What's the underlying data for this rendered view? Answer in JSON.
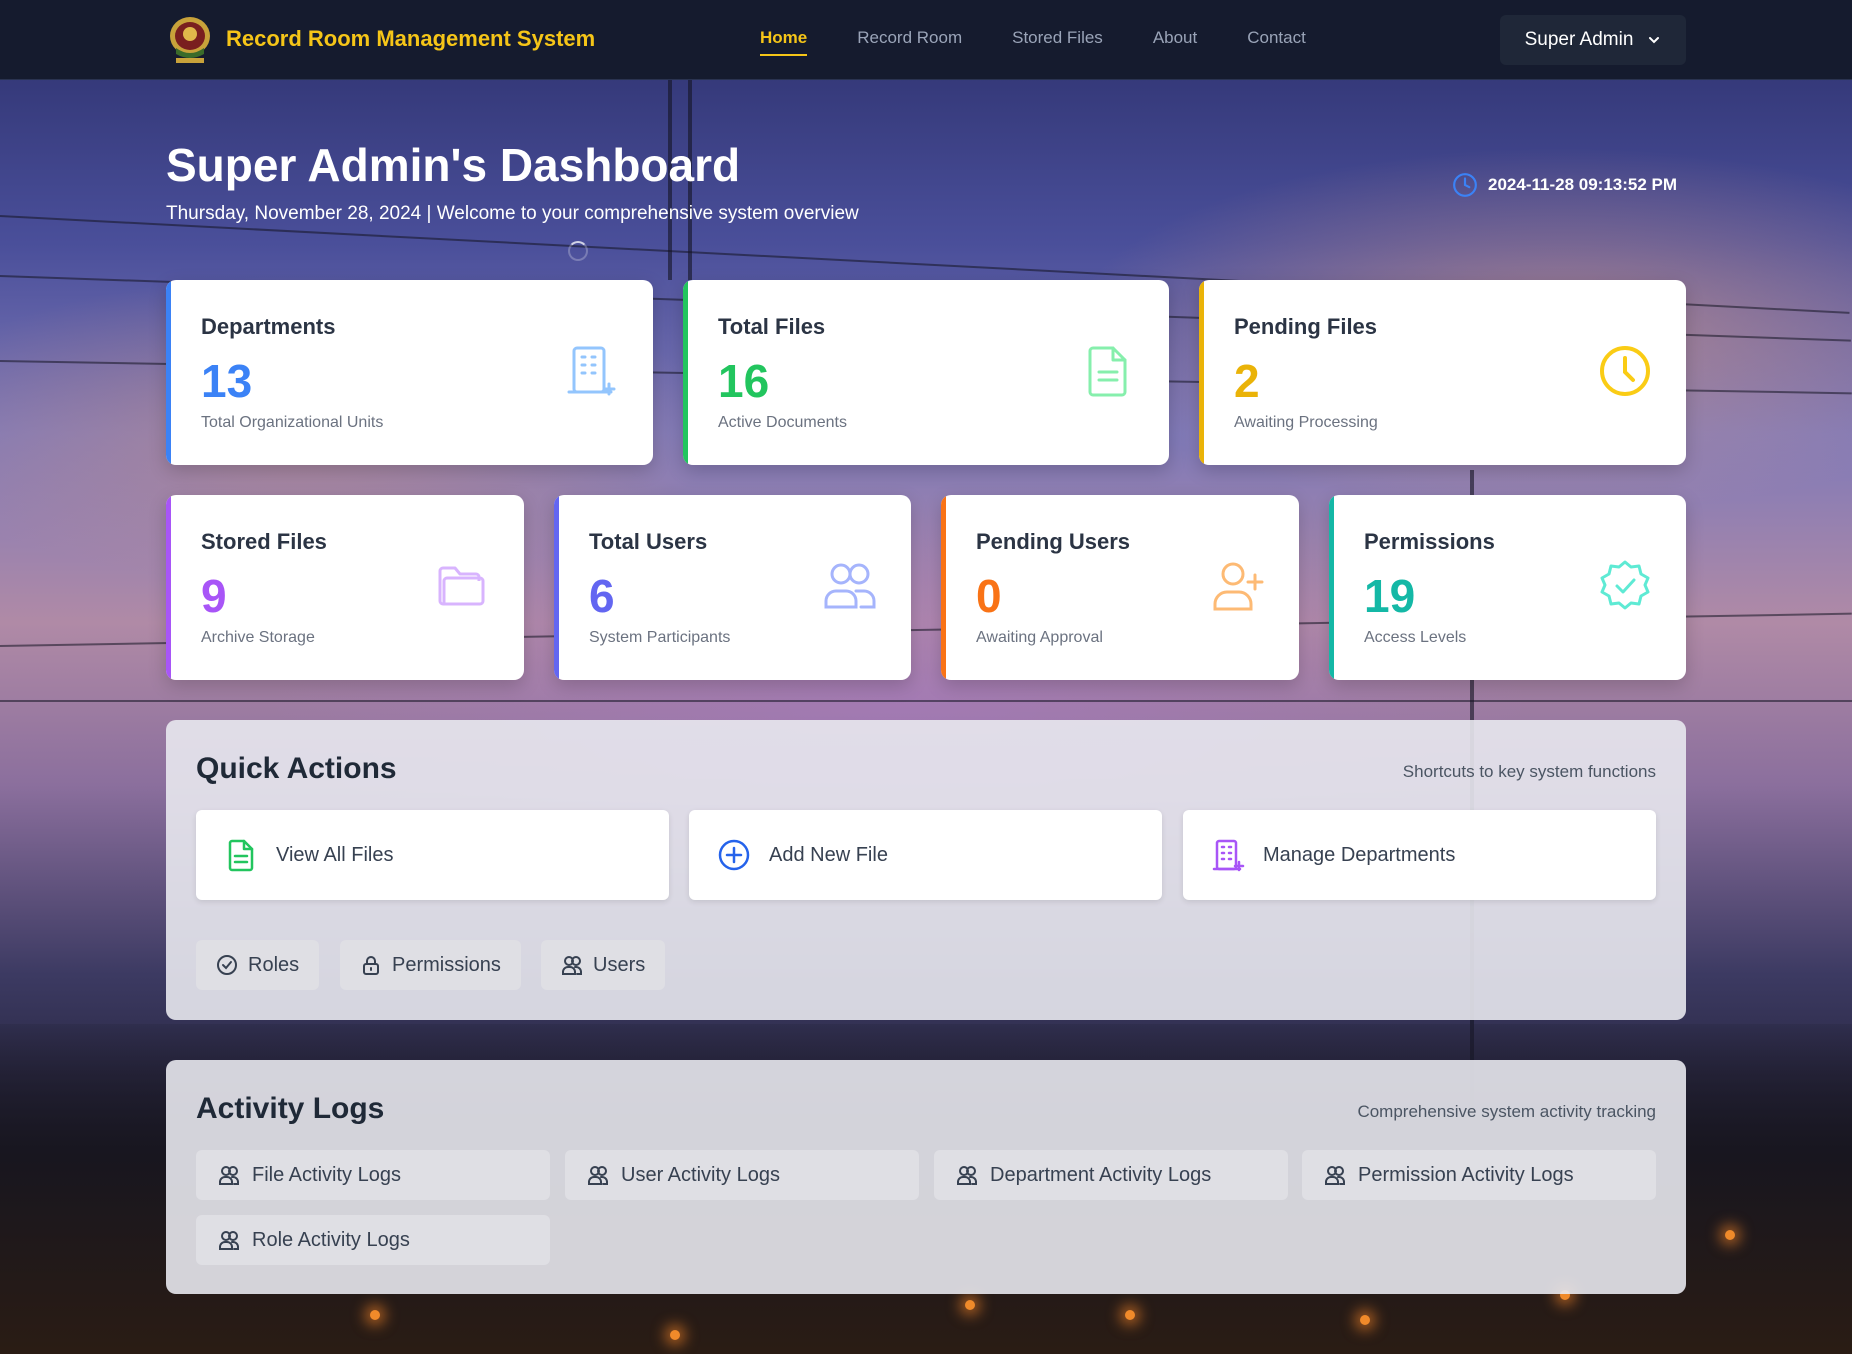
{
  "brand": {
    "title": "Record Room Management System"
  },
  "nav": {
    "items": [
      {
        "label": "Home"
      },
      {
        "label": "Record Room"
      },
      {
        "label": "Stored Files"
      },
      {
        "label": "About"
      },
      {
        "label": "Contact"
      }
    ],
    "active": "Home"
  },
  "user_menu": {
    "label": "Super Admin"
  },
  "header": {
    "title": "Super Admin's Dashboard",
    "subtitle": "Thursday, November 28, 2024 | Welcome to your comprehensive system overview",
    "datetime": "2024-11-28 09:13:52 PM"
  },
  "stats": {
    "departments": {
      "title": "Departments",
      "value": "13",
      "sub": "Total Organizational Units",
      "color": "#3b82f6",
      "icon": "building-icon"
    },
    "total_files": {
      "title": "Total Files",
      "value": "16",
      "sub": "Active Documents",
      "color": "#22c55e",
      "icon": "file-icon"
    },
    "pending_files": {
      "title": "Pending Files",
      "value": "2",
      "sub": "Awaiting Processing",
      "color": "#eab308",
      "icon": "clock-icon"
    },
    "stored_files": {
      "title": "Stored Files",
      "value": "9",
      "sub": "Archive Storage",
      "color": "#a855f7",
      "icon": "folder-icon"
    },
    "total_users": {
      "title": "Total Users",
      "value": "6",
      "sub": "System Participants",
      "color": "#6366f1",
      "icon": "users-icon"
    },
    "pending_users": {
      "title": "Pending Users",
      "value": "0",
      "sub": "Awaiting Approval",
      "color": "#f97316",
      "icon": "user-plus-icon"
    },
    "permissions": {
      "title": "Permissions",
      "value": "19",
      "sub": "Access Levels",
      "color": "#14b8a6",
      "icon": "badge-check-icon"
    }
  },
  "quick_actions": {
    "title": "Quick Actions",
    "description": "Shortcuts to key system functions",
    "cards": [
      {
        "label": "View All Files",
        "icon": "file-icon"
      },
      {
        "label": "Add New File",
        "icon": "plus-circle-icon"
      },
      {
        "label": "Manage Departments",
        "icon": "building-icon"
      }
    ],
    "chips": [
      {
        "label": "Roles",
        "icon": "check-circle-icon"
      },
      {
        "label": "Permissions",
        "icon": "lock-icon"
      },
      {
        "label": "Users",
        "icon": "users-icon"
      }
    ]
  },
  "activity_logs": {
    "title": "Activity Logs",
    "description": "Comprehensive system activity tracking",
    "items": [
      {
        "label": "File Activity Logs"
      },
      {
        "label": "User Activity Logs"
      },
      {
        "label": "Department Activity Logs"
      },
      {
        "label": "Permission Activity Logs"
      },
      {
        "label": "Role Activity Logs"
      }
    ]
  }
}
